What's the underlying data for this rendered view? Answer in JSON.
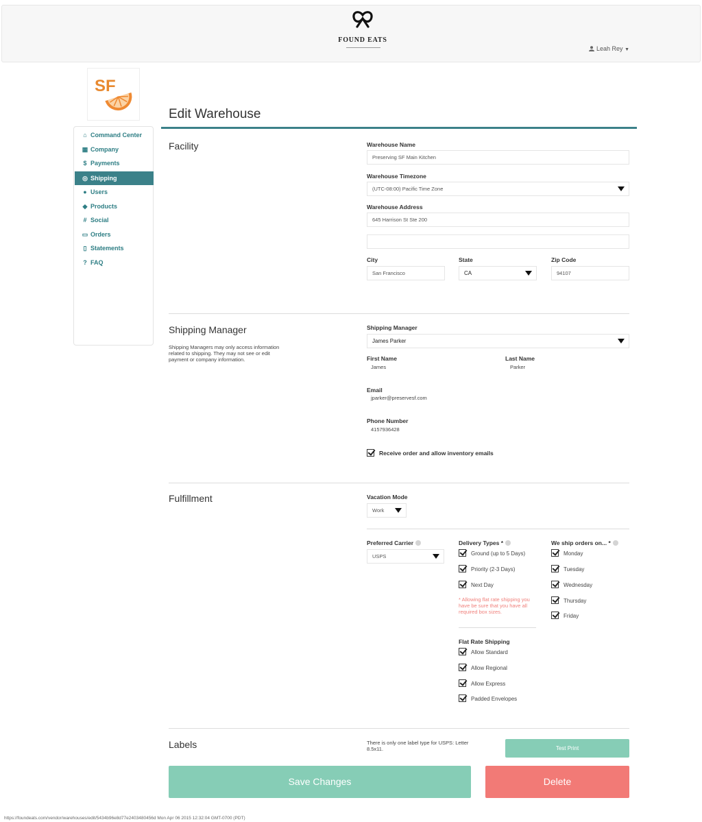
{
  "header": {
    "brand": "FOUND EATS",
    "user_name": "Leah Rey"
  },
  "brand_tile": {
    "text": "SF"
  },
  "sidebar": {
    "items": [
      {
        "label": "Command Center",
        "icon": "home-icon"
      },
      {
        "label": "Company",
        "icon": "store-icon"
      },
      {
        "label": "Payments",
        "icon": "dollar-icon"
      },
      {
        "label": "Shipping",
        "icon": "shipping-icon",
        "active": true
      },
      {
        "label": "Users",
        "icon": "user-icon"
      },
      {
        "label": "Products",
        "icon": "cube-icon"
      },
      {
        "label": "Social",
        "icon": "hashtag-icon"
      },
      {
        "label": "Orders",
        "icon": "orders-icon"
      },
      {
        "label": "Statements",
        "icon": "document-icon"
      },
      {
        "label": "FAQ",
        "icon": "question-icon"
      }
    ]
  },
  "page": {
    "title": "Edit Warehouse"
  },
  "facility": {
    "section_title": "Facility",
    "warehouse_name_label": "Warehouse Name",
    "warehouse_name_value": "Preserving SF Main Kitchen",
    "timezone_label": "Warehouse Timezone",
    "timezone_value": "(UTC-08:00) Pacific Time Zone",
    "address_label": "Warehouse Address",
    "address_line1": "645 Harrison St Ste 200",
    "address_line2": "",
    "city_label": "City",
    "city_value": "San Francisco",
    "state_label": "State",
    "state_value": "CA",
    "zip_label": "Zip Code",
    "zip_value": "94107"
  },
  "shipping_manager": {
    "section_title": "Shipping Manager",
    "description": "Shipping Managers may only access information related to shipping. They may not see or edit payment or company information.",
    "select_label": "Shipping Manager",
    "select_value": "James Parker",
    "first_name_label": "First Name",
    "first_name_value": "James",
    "last_name_label": "Last Name",
    "last_name_value": "Parker",
    "email_label": "Email",
    "email_value": "jparker@preservesf.com",
    "phone_label": "Phone Number",
    "phone_value": "4157936428",
    "emails_checkbox_label": "Receive order and allow inventory emails",
    "emails_checked": true
  },
  "fulfillment": {
    "section_title": "Fulfillment",
    "vacation_label": "Vacation Mode",
    "vacation_value": "Work",
    "carrier_label": "Preferred Carrier",
    "carrier_value": "USPS",
    "delivery_label": "Delivery Types *",
    "delivery_types": [
      {
        "label": "Ground (up to 5 Days)",
        "checked": true
      },
      {
        "label": "Priority (2-3 Days)",
        "checked": true
      },
      {
        "label": "Next Day",
        "checked": true
      }
    ],
    "delivery_warning": "* Allowing flat rate shipping you have be sure that you have all required box sizes.",
    "ship_days_label": "We ship orders on... *",
    "ship_days": [
      {
        "label": "Monday",
        "checked": true
      },
      {
        "label": "Tuesday",
        "checked": true
      },
      {
        "label": "Wednesday",
        "checked": true
      },
      {
        "label": "Thursday",
        "checked": true
      },
      {
        "label": "Friday",
        "checked": true
      }
    ],
    "flat_rate_label": "Flat Rate Shipping",
    "flat_rate": [
      {
        "label": "Allow Standard",
        "checked": true
      },
      {
        "label": "Allow Regional",
        "checked": true
      },
      {
        "label": "Allow Express",
        "checked": true
      },
      {
        "label": "Padded Envelopes",
        "checked": true
      }
    ]
  },
  "labels": {
    "section_title": "Labels",
    "description": "There is only one label type for USPS: Letter 8.5x11.",
    "test_print": "Test Print"
  },
  "actions": {
    "save": "Save Changes",
    "delete": "Delete"
  },
  "footer": {
    "url_text": "https://foundeats.com/vendor/warehouses/edit/5434b96e8d77e2403480456d Mon Apr 06 2015 12:32:04 GMT-0700 (PDT)"
  },
  "colors": {
    "teal": "#3b8189",
    "mint": "#86cdb6",
    "coral": "#f27a76",
    "sf_orange": "#e8892f"
  }
}
